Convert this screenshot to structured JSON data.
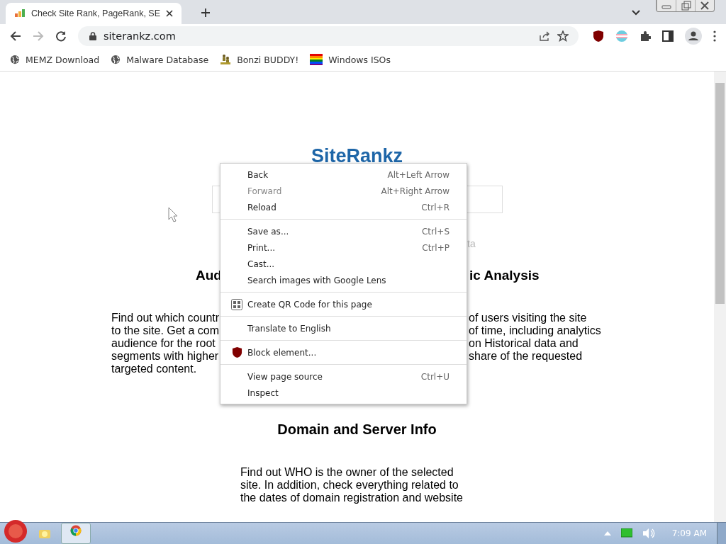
{
  "browser": {
    "tabs": [
      {
        "title": "Check Site Rank, PageRank, SE",
        "selected": true
      }
    ],
    "address": "siterankz.com",
    "bookmarks": [
      {
        "label": "MEMZ Download",
        "kind": "globe"
      },
      {
        "label": "Malware Database",
        "kind": "globe"
      },
      {
        "label": "Bonzi BUDDY!",
        "kind": "figures"
      },
      {
        "label": "Windows ISOs",
        "kind": "flag"
      }
    ]
  },
  "page": {
    "logo": "SiteRankz",
    "hint_fragment": "ta",
    "heading_left": "Aud",
    "heading_right": "ic Analysis",
    "paragraph_left": [
      "Find out which countr",
      "to the site. Get a com",
      "audience for the root",
      "segments with higher",
      "targeted content."
    ],
    "paragraph_right": [
      "of users visiting the site",
      "of time, including analytics",
      "on Historical data and",
      "share of the requested"
    ],
    "heading2": "Domain and Server Info",
    "paragraph2": [
      "Find out WHO is the owner of the selected",
      "site. In addition, check everything related to",
      "the dates of domain registration and website"
    ]
  },
  "context_menu": {
    "groups": [
      [
        {
          "label": "Back",
          "shortcut": "Alt+Left Arrow",
          "disabled": false
        },
        {
          "label": "Forward",
          "shortcut": "Alt+Right Arrow",
          "disabled": true
        },
        {
          "label": "Reload",
          "shortcut": "Ctrl+R",
          "disabled": false
        }
      ],
      [
        {
          "label": "Save as...",
          "shortcut": "Ctrl+S",
          "disabled": false
        },
        {
          "label": "Print...",
          "shortcut": "Ctrl+P",
          "disabled": false
        },
        {
          "label": "Cast...",
          "disabled": false
        },
        {
          "label": "Search images with Google Lens",
          "disabled": false
        }
      ],
      [
        {
          "label": "Create QR Code for this page",
          "kind": "grid",
          "disabled": false
        }
      ],
      [
        {
          "label": "Translate to English",
          "disabled": false
        }
      ],
      [
        {
          "label": "Block element...",
          "kind": "shield",
          "disabled": false
        }
      ],
      [
        {
          "label": "View page source",
          "shortcut": "Ctrl+U",
          "disabled": false
        },
        {
          "label": "Inspect",
          "disabled": false
        }
      ]
    ]
  },
  "taskbar": {
    "clock": "7:09 AM"
  }
}
